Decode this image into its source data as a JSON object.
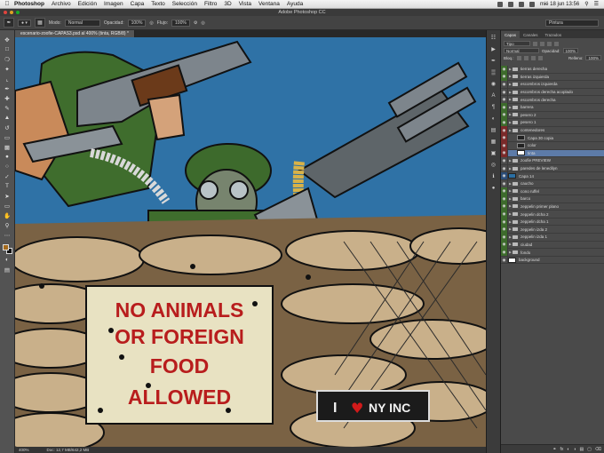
{
  "menubar": {
    "app": "Photoshop",
    "items": [
      "Archivo",
      "Edición",
      "Imagen",
      "Capa",
      "Texto",
      "Selección",
      "Filtro",
      "3D",
      "Vista",
      "Ventana",
      "Ayuda"
    ],
    "clock": "mié 18 jun 13:56"
  },
  "window": {
    "title": "Adobe Photoshop CC"
  },
  "options": {
    "mode_label": "Modo:",
    "mode_value": "Normal",
    "opacity_label": "Opacidad:",
    "opacity_value": "100%",
    "flow_label": "Flujo:",
    "flow_value": "100%",
    "workspace": "Pintura"
  },
  "document": {
    "tab": "escenario-zoofie-CAPAS3.psd al 400% (tinta, RGB/8) *",
    "zoom": "400%",
    "doc_size": "Doc: 12,7 MB/642,2 MB"
  },
  "artwork": {
    "sign_lines": [
      "NO ANIMALS",
      "OR FOREIGN",
      "FOOD",
      "ALLOWED"
    ],
    "sticker_prefix": "I",
    "sticker_suffix": "NY INC"
  },
  "layers_panel": {
    "tabs": [
      "Capas",
      "Canales",
      "Trazados"
    ],
    "filter_kind": "Tipo",
    "blend_mode": "Normal",
    "opacity_label": "Opacidad:",
    "opacity_value": "100%",
    "lock_label": "Bloq.:",
    "fill_label": "Relleno:",
    "fill_value": "100%",
    "layers": [
      {
        "name": "tierras derecha",
        "eye": "green",
        "type": "folder"
      },
      {
        "name": "tierras izquierda",
        "eye": "green",
        "type": "folder"
      },
      {
        "name": "escombros izquierda",
        "eye": "",
        "type": "folder"
      },
      {
        "name": "escombros derecha acoplado",
        "eye": "",
        "type": "folder"
      },
      {
        "name": "escombros derecha",
        "eye": "",
        "type": "folder"
      },
      {
        "name": "barrera",
        "eye": "green",
        "type": "folder"
      },
      {
        "name": "pesero 2",
        "eye": "green",
        "type": "folder"
      },
      {
        "name": "pesero 1",
        "eye": "green",
        "type": "folder"
      },
      {
        "name": "contenedores",
        "eye": "red",
        "type": "folder"
      },
      {
        "name": "Capa 30 copia",
        "eye": "red",
        "type": "thumb-dark"
      },
      {
        "name": "color",
        "eye": "red",
        "type": "thumb-dark"
      },
      {
        "name": "tinta",
        "eye": "red",
        "type": "thumb",
        "selected": true
      },
      {
        "name": "zoofie PREVIEW",
        "eye": "",
        "type": "folder"
      },
      {
        "name": "paredes de lenedilyn",
        "eye": "",
        "type": "folder"
      },
      {
        "name": "Capa 14",
        "eye": "blue",
        "type": "thumb-blue"
      },
      {
        "name": "caucho",
        "eye": "",
        "type": "folder"
      },
      {
        "name": "cono ruffel",
        "eye": "green",
        "type": "folder"
      },
      {
        "name": "barco",
        "eye": "green",
        "type": "folder"
      },
      {
        "name": "zeppelin primer plano",
        "eye": "green",
        "type": "folder"
      },
      {
        "name": "zeppelin dcha 2",
        "eye": "green",
        "type": "folder"
      },
      {
        "name": "zeppelin dcha 1",
        "eye": "green",
        "type": "folder"
      },
      {
        "name": "zeppelin izda 2",
        "eye": "green",
        "type": "folder"
      },
      {
        "name": "zeppelin izda 1",
        "eye": "green",
        "type": "folder"
      },
      {
        "name": "ciudad",
        "eye": "green",
        "type": "folder"
      },
      {
        "name": "fondo",
        "eye": "green",
        "type": "folder"
      },
      {
        "name": "background",
        "eye": "",
        "type": "thumb"
      }
    ]
  }
}
